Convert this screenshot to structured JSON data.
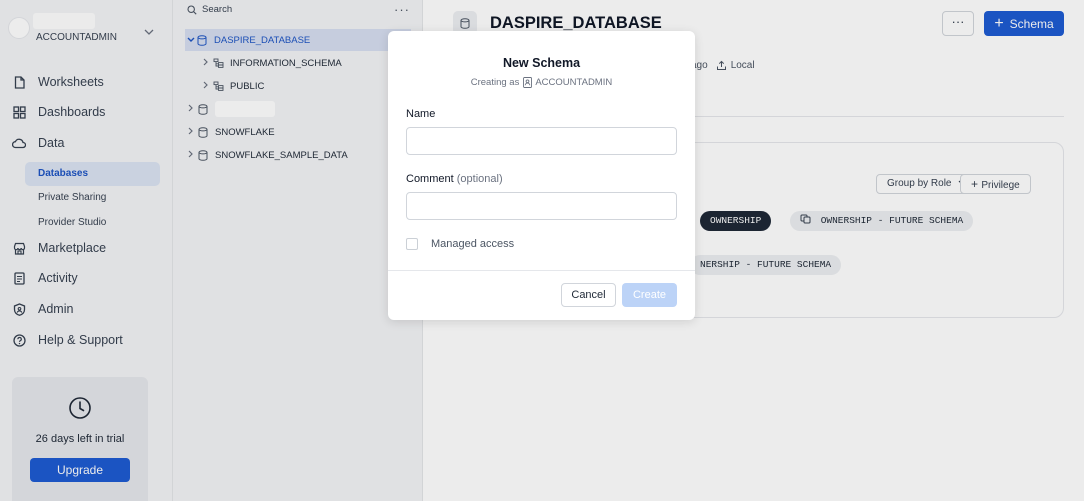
{
  "nav": {
    "account": {
      "role": "ACCOUNTADMIN",
      "chevron_icon": "chevron-down-icon"
    },
    "items": [
      {
        "label": "Worksheets",
        "icon": "worksheet-icon"
      },
      {
        "label": "Dashboards",
        "icon": "dashboard-icon"
      },
      {
        "label": "Data",
        "icon": "cloud-icon"
      }
    ],
    "data_sub_items": [
      {
        "label": "Databases",
        "active": true
      },
      {
        "label": "Private Sharing",
        "active": false
      },
      {
        "label": "Provider Studio",
        "active": false
      }
    ],
    "items_lower": [
      {
        "label": "Marketplace",
        "icon": "store-icon"
      },
      {
        "label": "Activity",
        "icon": "activity-icon"
      },
      {
        "label": "Admin",
        "icon": "shield-icon"
      },
      {
        "label": "Help & Support",
        "icon": "help-icon"
      }
    ],
    "trial": {
      "text": "26 days left in trial",
      "upgrade_label": "Upgrade"
    }
  },
  "explorer": {
    "search_label": "Search",
    "more_label": "···",
    "tree": [
      {
        "label": "DASPIRE_DATABASE",
        "type": "database",
        "expanded": true,
        "selected": true
      },
      {
        "label": "INFORMATION_SCHEMA",
        "type": "schema"
      },
      {
        "label": "PUBLIC",
        "type": "schema"
      },
      {
        "label": "",
        "type": "database",
        "redacted": true
      },
      {
        "label": "SNOWFLAKE",
        "type": "database"
      },
      {
        "label": "SNOWFLAKE_SAMPLE_DATA",
        "type": "database"
      }
    ]
  },
  "main": {
    "title": "DASPIRE_DATABASE",
    "more_label": "···",
    "schema_button_label": "Schema",
    "meta": {
      "ago": "ago",
      "location": "Local"
    },
    "privileges": {
      "group_by_label": "Group by Role",
      "privilege_label": "Privilege",
      "pills_row1": [
        "OWNERSHIP",
        "OWNERSHIP - FUTURE SCHEMA"
      ],
      "pills_row2": [
        "NERSHIP - FUTURE SCHEMA"
      ]
    }
  },
  "modal": {
    "title": "New Schema",
    "subtitle_prefix": "Creating as",
    "subtitle_role": "ACCOUNTADMIN",
    "name_label": "Name",
    "name_value": "",
    "comment_label": "Comment",
    "comment_optional": "(optional)",
    "comment_value": "",
    "managed_access_label": "Managed access",
    "managed_access_checked": false,
    "cancel_label": "Cancel",
    "create_label": "Create"
  },
  "colors": {
    "primary": "#1e5bd2",
    "primary_disabled": "#bcd3f7",
    "selected_bg": "#d6def0",
    "nav_bg": "#f3f4f6"
  }
}
